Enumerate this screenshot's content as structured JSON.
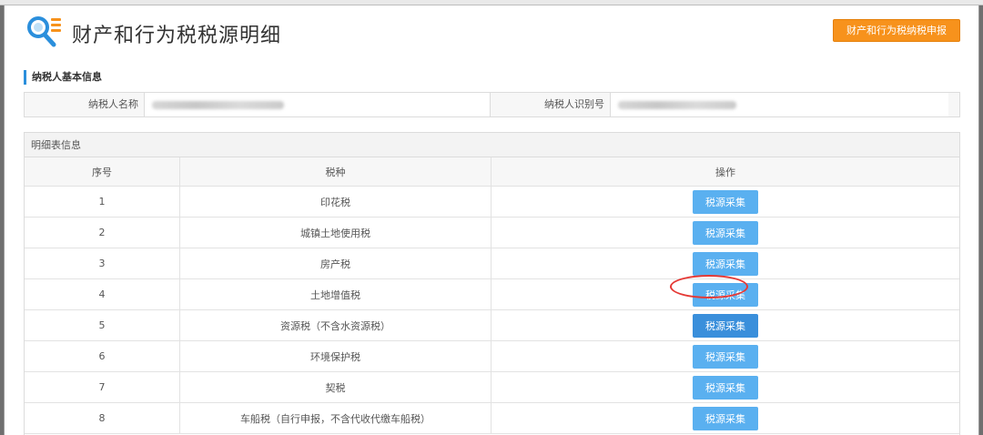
{
  "header": {
    "title": "财产和行为税税源明细",
    "declare_button": "财产和行为税纳税申报"
  },
  "taxpayer_info": {
    "section_title": "纳税人基本信息",
    "name_label": "纳税人名称",
    "id_label": "纳税人识别号"
  },
  "details": {
    "section_title": "明细表信息",
    "columns": [
      "序号",
      "税种",
      "操作"
    ],
    "rows": [
      {
        "no": "1",
        "tax": "印花税",
        "action": "税源采集"
      },
      {
        "no": "2",
        "tax": "城镇土地使用税",
        "action": "税源采集"
      },
      {
        "no": "3",
        "tax": "房产税",
        "action": "税源采集"
      },
      {
        "no": "4",
        "tax": "土地增值税",
        "action": "税源采集"
      },
      {
        "no": "5",
        "tax": "资源税（不含水资源税）",
        "action": "税源采集"
      },
      {
        "no": "6",
        "tax": "环境保护税",
        "action": "税源采集"
      },
      {
        "no": "7",
        "tax": "契税",
        "action": "税源采集"
      },
      {
        "no": "8",
        "tax": "车船税（自行申报，不含代收代缴车船税）",
        "action": "税源采集"
      }
    ]
  },
  "colors": {
    "accent_orange": "#f7921c",
    "button_blue": "#5ab0f0",
    "button_blue_active": "#3a8fdb",
    "section_marker": "#2b8fdc",
    "annotation_red": "#e53935"
  }
}
